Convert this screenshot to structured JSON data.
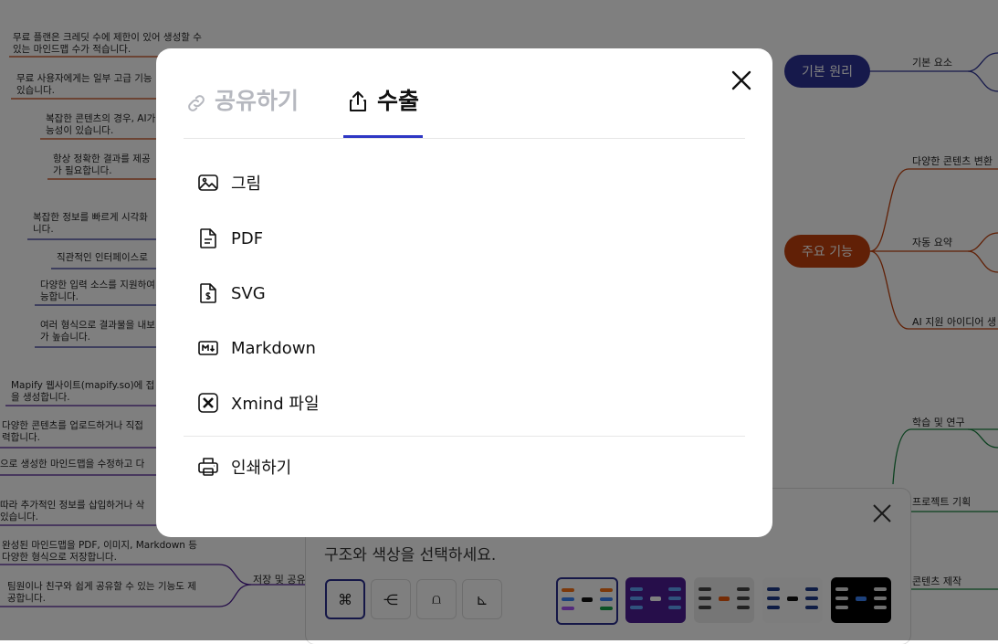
{
  "background_mindmap": {
    "left_texts": [
      {
        "line1": "무료 플랜은 크레딧 수에 제한이 있어 생성할 수",
        "line2": "있는 마인드맵 수가 적습니다."
      },
      {
        "line1": "무료 사용자에게는 일부 고급 기능",
        "line2": "있습니다."
      },
      {
        "line1": "복잡한 콘텐츠의 경우, AI가",
        "line2": "능성이 있습니다."
      },
      {
        "line1": "항상 정확한 결과를 제공",
        "line2": "가 필요합니다."
      },
      {
        "line1": "복잡한 정보를 빠르게 시각화",
        "line2": "니다."
      },
      {
        "line1": "직관적인 인터페이스로",
        "line2": ""
      },
      {
        "line1": "다양한 입력 소스를 지원하여",
        "line2": "능합니다."
      },
      {
        "line1": "여러 형식으로 결과물을 내보",
        "line2": "가 높습니다."
      },
      {
        "line1": "Mapify 웹사이트(mapify.so)에 접",
        "line2": "을 생성합니다."
      },
      {
        "line1": "다양한 콘텐츠를 업로드하거나 직접",
        "line2": "력합니다."
      },
      {
        "line1": "으로 생성한 마인드맵을 수정하고 다",
        "line2": ""
      },
      {
        "line1": "따라 추가적인 정보를 삽입하거나 삭",
        "line2": "있습니다."
      },
      {
        "line1": "완성된 마인드맵을 PDF, 이미지, Markdown 등",
        "line2": "다양한 형식으로 저장합니다."
      },
      {
        "line1": "팀원이나 친구와 쉽게 공유할 수 있는 기능도 제",
        "line2": "공합니다."
      }
    ],
    "branch_label": "저장 및 공유",
    "nodes": [
      {
        "label": "기본 원리",
        "color": "#2d3296"
      },
      {
        "label": "주요 기능",
        "color": "#c2410c"
      }
    ],
    "sub_labels": {
      "basic_elements": "기본 요소",
      "content_conversion": "다양한 콘텐츠 변환",
      "auto_summary": "자동 요약",
      "ai_ideas": "AI 지원 아이디어 생",
      "learning": "학습 및 연구",
      "project": "프로젝트 기획",
      "content_making": "콘텐츠 제작"
    }
  },
  "theme_panel": {
    "description": "구조와 색상을 선택하세요.",
    "structure_buttons": [
      "⌘",
      "⋲",
      "⩍",
      "⊾"
    ]
  },
  "modal": {
    "tabs": {
      "share": "공유하기",
      "export": "수출"
    },
    "export_items": [
      {
        "label": "그림",
        "icon": "image-icon"
      },
      {
        "label": "PDF",
        "icon": "pdf-file-icon"
      },
      {
        "label": "SVG",
        "icon": "svg-file-icon"
      },
      {
        "label": "Markdown",
        "icon": "markdown-icon"
      },
      {
        "label": "Xmind 파일",
        "icon": "xmind-icon"
      }
    ],
    "print_label": "인쇄하기",
    "accent_color": "#2e37c4"
  }
}
